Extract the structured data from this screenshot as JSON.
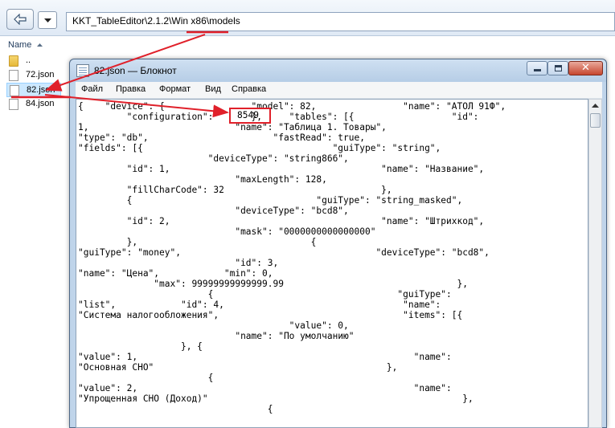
{
  "explorer": {
    "address_path": "KKT_TableEditor\\2.1.2\\Win x86\\models",
    "column_name": "Name",
    "files": [
      {
        "name": "..",
        "type": "folder",
        "selected": false
      },
      {
        "name": "72.json",
        "type": "file",
        "selected": false
      },
      {
        "name": "82.json",
        "type": "file",
        "selected": true
      },
      {
        "name": "84.json",
        "type": "file",
        "selected": false
      }
    ]
  },
  "notepad": {
    "title": "82.json — Блокнот",
    "menu": [
      "Файл",
      "Правка",
      "Формат",
      "Вид",
      "Справка"
    ],
    "close_glyph": "✕",
    "content": "{    \"device\": {                \"model\": 82,                \"name\": \"АТОЛ 91Ф\",\n         \"configuration\":       },     \"tables\": [{                  \"id\":\n1,                           \"name\": \"Таблица 1. Товары\",\n\"type\": \"db\",                       \"fastRead\": true,\n\"fields\": [{                                   \"guiType\": \"string\",\n                        \"deviceType\": \"string866\",\n         \"id\": 1,                                       \"name\": \"Название\",\n                             \"maxLength\": 128,\n         \"fillCharCode\": 32                             },\n         {                                  \"guiType\": \"string_masked\",\n                             \"deviceType\": \"bcd8\",\n         \"id\": 2,                                       \"name\": \"Штрихкод\",\n                             \"mask\": \"0000000000000000\"\n         },                                {\n\"guiType\": \"money\",                                    \"deviceType\": \"bcd8\",\n                             \"id\": 3,\n\"name\": \"Цена\",            \"min\": 0,\n              \"max\": 99999999999999.99                                },\n                        {                                  \"guiType\":\n\"list\",            \"id\": 4,                                 \"name\":\n\"Система налогообложения\",                                  \"items\": [{\n                                       \"value\": 0,\n                             \"name\": \"По умолчанию\"\n                   }, {\n\"value\": 1,                                                   \"name\":\n\"Основная СНО\"                                           },\n                        {\n\"value\": 2,                                                   \"name\":\n\"Упрощенная СНО (Доход)\"                                               },\n                                   {",
    "highlighted_value": "8549"
  },
  "annotation_color": "#e0202a"
}
